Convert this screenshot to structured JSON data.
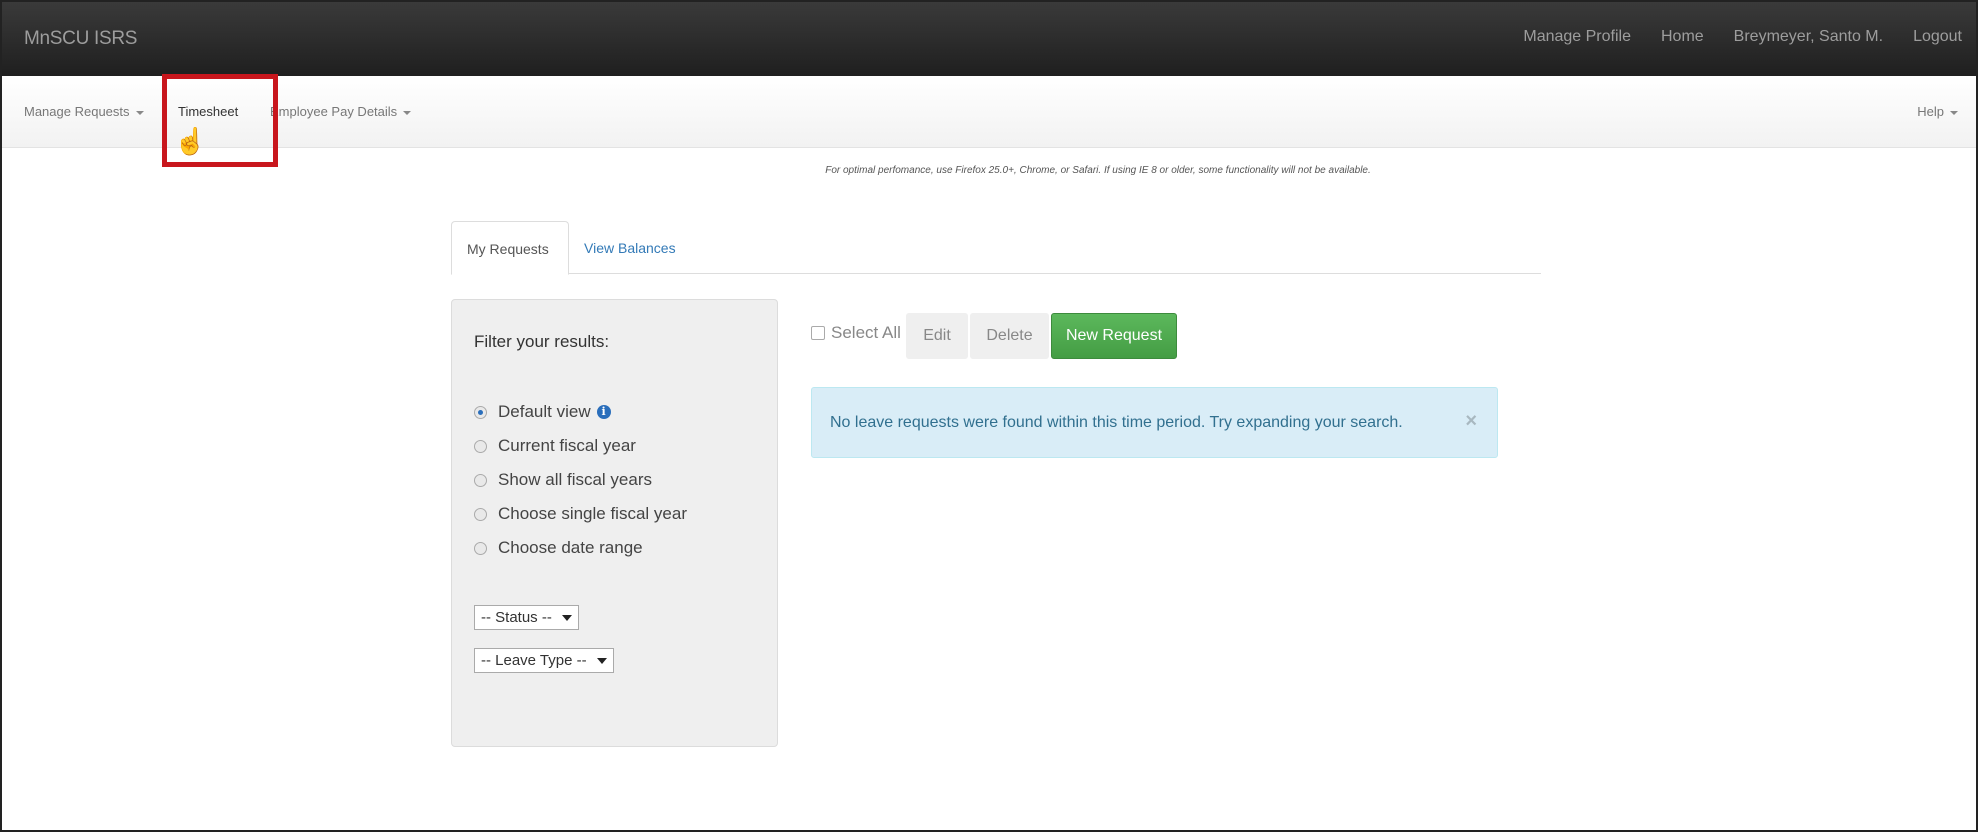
{
  "app": {
    "brand": "MnSCU ISRS"
  },
  "top_nav": {
    "items": [
      "Manage Profile",
      "Home",
      "Breymeyer, Santo M.",
      "Logout"
    ]
  },
  "sub_nav": {
    "manage_requests": "Manage Requests",
    "timesheet": "Timesheet",
    "employee_pay_details": "Employee Pay Details",
    "help": "Help"
  },
  "notice": "For optimal perfomance, use Firefox 25.0+, Chrome, or Safari. If using IE 8 or older, some functionality will not be available.",
  "tabs": [
    "My Requests",
    "View Balances"
  ],
  "filter": {
    "title": "Filter your results:",
    "options": [
      {
        "label": "Default view",
        "checked": true
      },
      {
        "label": "Current fiscal year",
        "checked": false
      },
      {
        "label": "Show all fiscal years",
        "checked": false
      },
      {
        "label": "Choose single fiscal year",
        "checked": false
      },
      {
        "label": "Choose date range",
        "checked": false
      }
    ],
    "status_select": "-- Status --",
    "leave_type_select": "-- Leave Type --"
  },
  "actions": {
    "select_all": "Select All",
    "edit": "Edit",
    "delete": "Delete",
    "new_request": "New Request"
  },
  "alert": {
    "message": "No leave requests were found within this time period. Try expanding your search.",
    "close": "×"
  },
  "colors": {
    "navbar": "#222222",
    "highlight": "#c8161d",
    "success": "#5cb85c",
    "info_bg": "#d9edf7",
    "link": "#337ab7"
  },
  "icons": {
    "cursor": "hand-pointer-icon",
    "info": "info-circle-icon",
    "close": "close-icon"
  }
}
